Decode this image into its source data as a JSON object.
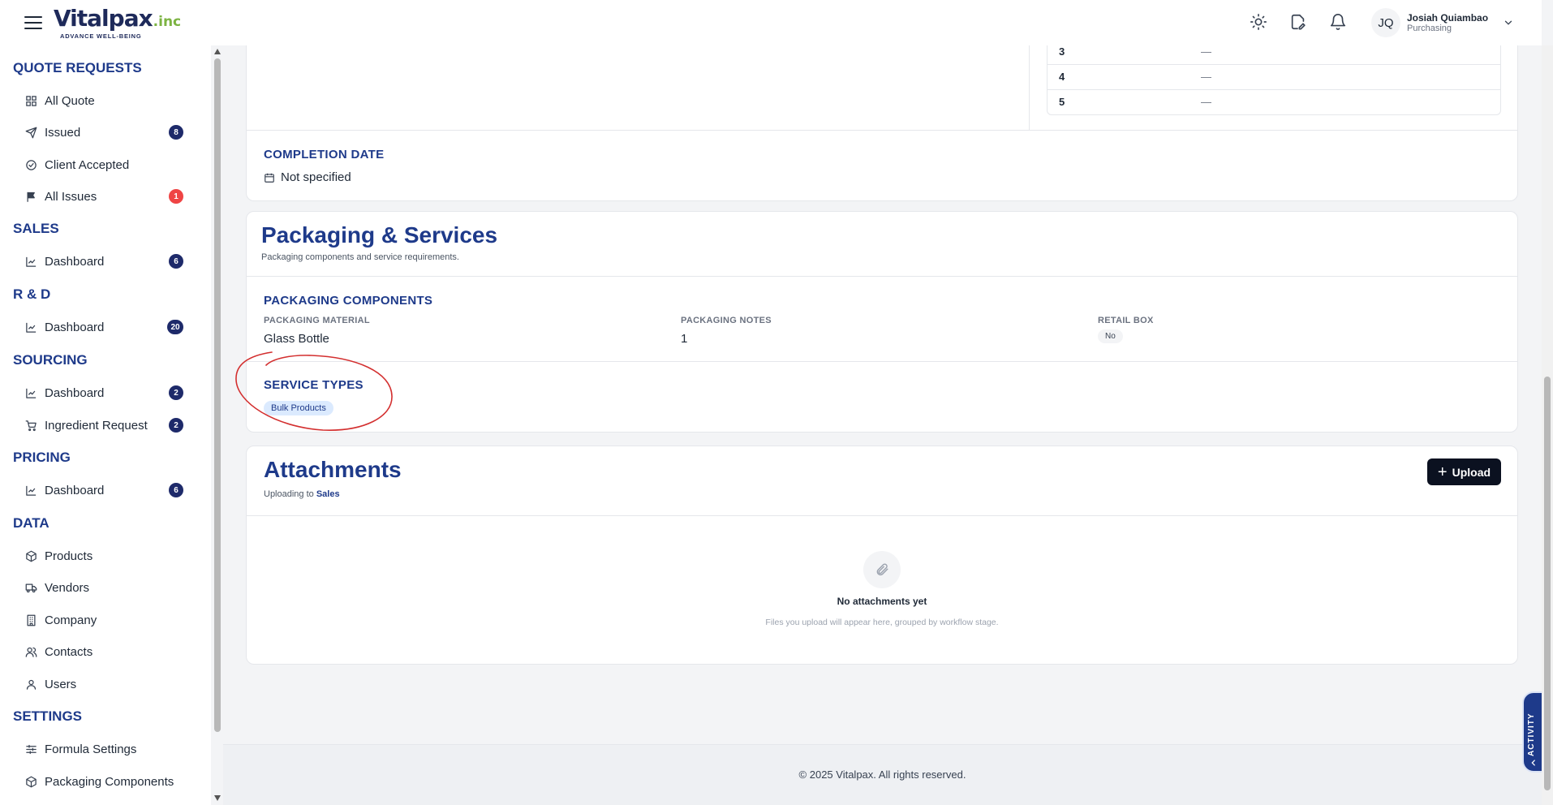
{
  "header": {
    "brand": "Vitalpax",
    "brand_suffix": ".inc",
    "tagline": "ADVANCE WELL-BEING",
    "user_initials": "JQ",
    "user_name": "Josiah Quiambao",
    "user_role": "Purchasing"
  },
  "sidebar": {
    "sections": [
      {
        "title": "QUOTE REQUESTS",
        "items": [
          {
            "label": "All Quote",
            "icon": "grid-icon",
            "badge": ""
          },
          {
            "label": "Issued",
            "icon": "send-icon",
            "badge": "8"
          },
          {
            "label": "Client Accepted",
            "icon": "check-circle-icon",
            "badge": ""
          },
          {
            "label": "All Issues",
            "icon": "flag-icon",
            "badge": "1"
          }
        ]
      },
      {
        "title": "SALES",
        "items": [
          {
            "label": "Dashboard",
            "icon": "chart-icon",
            "badge": "6"
          }
        ]
      },
      {
        "title": "R & D",
        "items": [
          {
            "label": "Dashboard",
            "icon": "chart-icon",
            "badge": "20"
          }
        ]
      },
      {
        "title": "SOURCING",
        "items": [
          {
            "label": "Dashboard",
            "icon": "chart-icon",
            "badge": "2"
          },
          {
            "label": "Ingredient Request",
            "icon": "cart-icon",
            "badge": "2"
          }
        ]
      },
      {
        "title": "PRICING",
        "items": [
          {
            "label": "Dashboard",
            "icon": "chart-icon",
            "badge": "6"
          }
        ]
      },
      {
        "title": "DATA",
        "items": [
          {
            "label": "Products",
            "icon": "box-icon",
            "badge": ""
          },
          {
            "label": "Vendors",
            "icon": "truck-icon",
            "badge": ""
          },
          {
            "label": "Company",
            "icon": "building-icon",
            "badge": ""
          },
          {
            "label": "Contacts",
            "icon": "contacts-icon",
            "badge": ""
          },
          {
            "label": "Users",
            "icon": "user-icon",
            "badge": ""
          }
        ]
      },
      {
        "title": "SETTINGS",
        "items": [
          {
            "label": "Formula Settings",
            "icon": "sliders-icon",
            "badge": ""
          },
          {
            "label": "Packaging Components",
            "icon": "box-icon",
            "badge": ""
          }
        ]
      }
    ]
  },
  "table_rows": [
    {
      "num": "3",
      "value": "—"
    },
    {
      "num": "4",
      "value": "—"
    },
    {
      "num": "5",
      "value": "—"
    }
  ],
  "completion": {
    "title": "COMPLETION DATE",
    "value": "Not specified"
  },
  "packaging": {
    "title": "Packaging & Services",
    "subtitle": "Packaging components and service requirements.",
    "components_title": "PACKAGING COMPONENTS",
    "material_label": "PACKAGING MATERIAL",
    "material_value": "Glass Bottle",
    "notes_label": "PACKAGING NOTES",
    "notes_value": "1",
    "retail_label": "RETAIL BOX",
    "retail_value": "No",
    "service_title": "SERVICE TYPES",
    "service_value": "Bulk Products"
  },
  "attachments": {
    "title": "Attachments",
    "uploading_prefix": "Uploading to",
    "uploading_target": "Sales",
    "upload_label": "Upload",
    "empty_title": "No attachments yet",
    "empty_sub": "Files you upload will appear here, grouped by workflow stage."
  },
  "footer": {
    "text": "© 2025 Vitalpax. All rights reserved."
  },
  "activity_label": "ACTIVITY",
  "colors": {
    "accent": "#1e3a8a",
    "badge": "#1e2a6a",
    "badge_alert": "#ef4444",
    "annotation": "#d32f2f"
  }
}
